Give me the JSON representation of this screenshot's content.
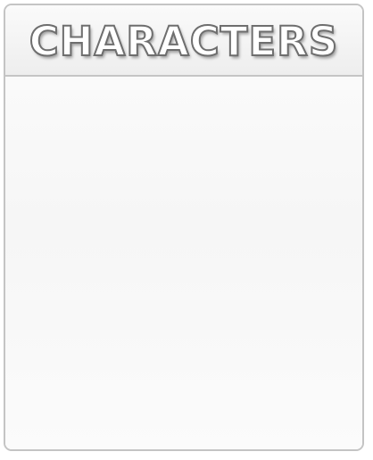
{
  "panel": {
    "title": "CHARACTERS",
    "title_fill_color": "#ffffff",
    "title_outline_color": "#6e6e6e",
    "border_color": "#c4c4c4",
    "background_color": "#fdfdfd"
  }
}
